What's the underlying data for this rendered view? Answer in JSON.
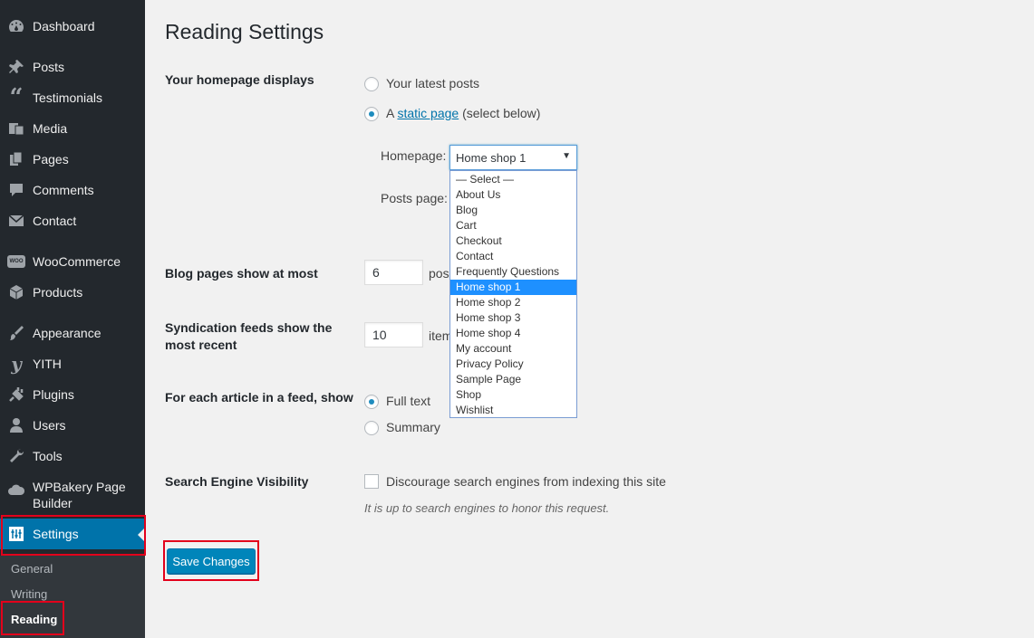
{
  "sidebar": {
    "items": [
      {
        "label": "Dashboard",
        "icon": "dashboard-icon"
      },
      {
        "label": "Posts",
        "icon": "pin-icon"
      },
      {
        "label": "Testimonials",
        "icon": "quote-icon"
      },
      {
        "label": "Media",
        "icon": "media-icon"
      },
      {
        "label": "Pages",
        "icon": "pages-icon"
      },
      {
        "label": "Comments",
        "icon": "comment-icon"
      },
      {
        "label": "Contact",
        "icon": "mail-icon"
      },
      {
        "label": "WooCommerce",
        "icon": "woo-icon"
      },
      {
        "label": "Products",
        "icon": "box-icon"
      },
      {
        "label": "Appearance",
        "icon": "brush-icon"
      },
      {
        "label": "YITH",
        "icon": "yith-icon"
      },
      {
        "label": "Plugins",
        "icon": "plug-icon"
      },
      {
        "label": "Users",
        "icon": "user-icon"
      },
      {
        "label": "Tools",
        "icon": "wrench-icon"
      },
      {
        "label": "WPBakery Page\nBuilder",
        "icon": "cloud-icon"
      },
      {
        "label": "Settings",
        "icon": "settings-icon"
      }
    ],
    "submenu": [
      "General",
      "Writing",
      "Reading"
    ],
    "woo_badge": "WOO"
  },
  "page": {
    "title": "Reading Settings",
    "homepage_displays": {
      "label": "Your homepage displays",
      "option_latest": "Your latest posts",
      "option_static_prefix": "A",
      "option_static_link": "static page",
      "option_static_suffix": "(select below)",
      "homepage_label": "Homepage:",
      "posts_page_label": "Posts page:",
      "homepage_value": "Home shop 1"
    },
    "dropdown_options": [
      "— Select —",
      "About Us",
      "Blog",
      "Cart",
      "Checkout",
      "Contact",
      "Frequently Questions",
      "Home shop 1",
      "Home shop 2",
      "Home shop 3",
      "Home shop 4",
      "My account",
      "Privacy Policy",
      "Sample Page",
      "Shop",
      "Wishlist"
    ],
    "dropdown_selected": "Home shop 1",
    "blog_pages": {
      "label": "Blog pages show at most",
      "value": "6",
      "unit": "pos"
    },
    "syndication": {
      "label": "Syndication feeds show the most recent",
      "value": "10",
      "unit": "item"
    },
    "feed_article": {
      "label": "For each article in a feed, show",
      "option_full": "Full text",
      "option_summary": "Summary"
    },
    "search_visibility": {
      "label": "Search Engine Visibility",
      "checkbox_label": "Discourage search engines from indexing this site",
      "description": "It is up to search engines to honor this request."
    },
    "save_label": "Save Changes"
  },
  "colors": {
    "sidebar_bg": "#23282d",
    "active_bg": "#0073aa",
    "button_bg": "#0085ba",
    "highlight": "#e3001b"
  }
}
